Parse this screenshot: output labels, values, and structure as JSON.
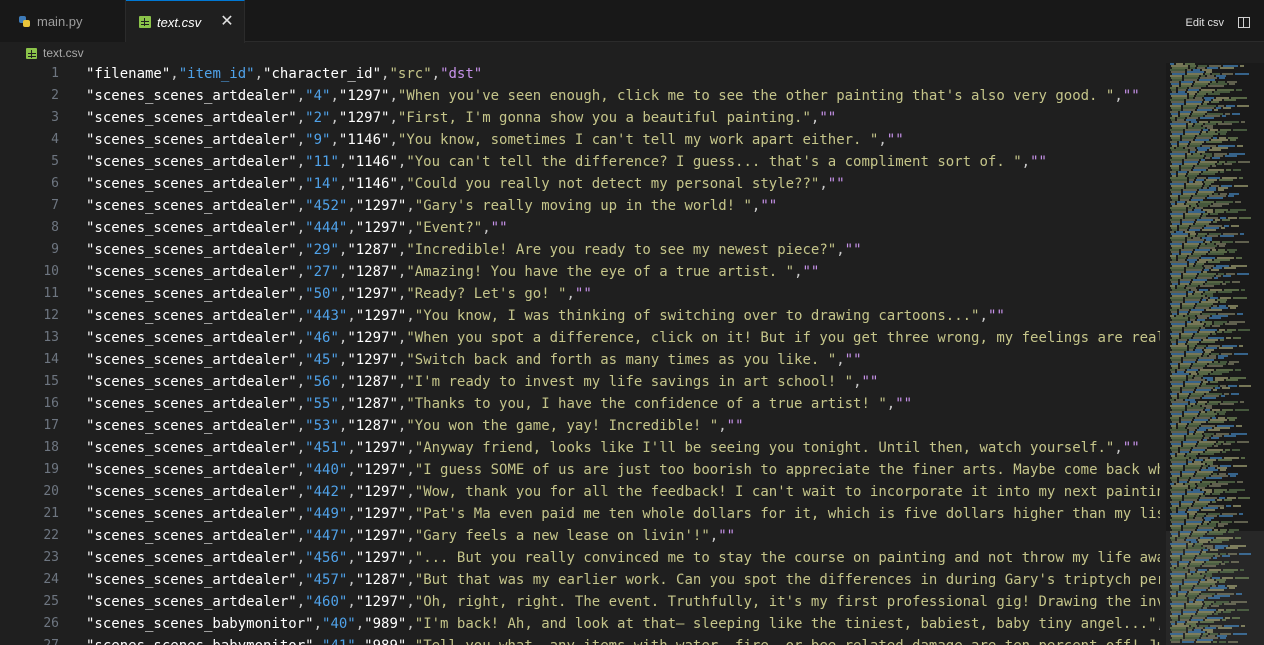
{
  "tabs": [
    {
      "label": "main.py",
      "icon": "python-icon",
      "active": false
    },
    {
      "label": "text.csv",
      "icon": "csv-file-icon",
      "active": true
    }
  ],
  "toolbar": {
    "edit_csv": "Edit csv",
    "split_icon": "split-editor-icon"
  },
  "breadcrumb": {
    "file": "text.csv"
  },
  "colors": {
    "col1": "#ffffff",
    "col2": "#4fa1e8",
    "col3": "#ffffff",
    "col4": "#c5c58a",
    "col5": "#c792ea",
    "accent": "#0078d4"
  },
  "lines": [
    {
      "n": "1",
      "cells": [
        "\"filename\"",
        "\"item_id\"",
        "\"character_id\"",
        "\"src\"",
        "\"dst\""
      ]
    },
    {
      "n": "2",
      "cells": [
        "\"scenes_scenes_artdealer\"",
        "\"4\"",
        "\"1297\"",
        "\"When you've seen enough, click me to see the other painting that's also very good. \"",
        "\"\""
      ]
    },
    {
      "n": "3",
      "cells": [
        "\"scenes_scenes_artdealer\"",
        "\"2\"",
        "\"1297\"",
        "\"First, I'm gonna show you a beautiful painting.\"",
        "\"\""
      ]
    },
    {
      "n": "4",
      "cells": [
        "\"scenes_scenes_artdealer\"",
        "\"9\"",
        "\"1146\"",
        "\"You know, sometimes I can't tell my work apart either. \"",
        "\"\""
      ]
    },
    {
      "n": "5",
      "cells": [
        "\"scenes_scenes_artdealer\"",
        "\"11\"",
        "\"1146\"",
        "\"You can't tell the difference? I guess... that's a compliment sort of. \"",
        "\"\""
      ]
    },
    {
      "n": "6",
      "cells": [
        "\"scenes_scenes_artdealer\"",
        "\"14\"",
        "\"1146\"",
        "\"Could you really not detect my personal style??\"",
        "\"\""
      ]
    },
    {
      "n": "7",
      "cells": [
        "\"scenes_scenes_artdealer\"",
        "\"452\"",
        "\"1297\"",
        "\"Gary's really moving up in the world! \"",
        "\"\""
      ]
    },
    {
      "n": "8",
      "cells": [
        "\"scenes_scenes_artdealer\"",
        "\"444\"",
        "\"1297\"",
        "\"Event?\"",
        "\"\""
      ]
    },
    {
      "n": "9",
      "cells": [
        "\"scenes_scenes_artdealer\"",
        "\"29\"",
        "\"1287\"",
        "\"Incredible! Are you ready to see my newest piece?\"",
        "\"\""
      ]
    },
    {
      "n": "10",
      "cells": [
        "\"scenes_scenes_artdealer\"",
        "\"27\"",
        "\"1287\"",
        "\"Amazing! You have the eye of a true artist. \"",
        "\"\""
      ]
    },
    {
      "n": "11",
      "cells": [
        "\"scenes_scenes_artdealer\"",
        "\"50\"",
        "\"1297\"",
        "\"Ready? Let's go! \"",
        "\"\""
      ]
    },
    {
      "n": "12",
      "cells": [
        "\"scenes_scenes_artdealer\"",
        "\"443\"",
        "\"1297\"",
        "\"You know, I was thinking of switching over to drawing cartoons...\"",
        "\"\""
      ]
    },
    {
      "n": "13",
      "cells": [
        "\"scenes_scenes_artdealer\"",
        "\"46\"",
        "\"1297\"",
        "\"When you spot a difference, click on it! But if you get three wrong, my feelings are really goi",
        ""
      ]
    },
    {
      "n": "14",
      "cells": [
        "\"scenes_scenes_artdealer\"",
        "\"45\"",
        "\"1297\"",
        "\"Switch back and forth as many times as you like. \"",
        "\"\""
      ]
    },
    {
      "n": "15",
      "cells": [
        "\"scenes_scenes_artdealer\"",
        "\"56\"",
        "\"1287\"",
        "\"I'm ready to invest my life savings in art school! \"",
        "\"\""
      ]
    },
    {
      "n": "16",
      "cells": [
        "\"scenes_scenes_artdealer\"",
        "\"55\"",
        "\"1287\"",
        "\"Thanks to you, I have the confidence of a true artist! \"",
        "\"\""
      ]
    },
    {
      "n": "17",
      "cells": [
        "\"scenes_scenes_artdealer\"",
        "\"53\"",
        "\"1287\"",
        "\"You won the game, yay! Incredible! \"",
        "\"\""
      ]
    },
    {
      "n": "18",
      "cells": [
        "\"scenes_scenes_artdealer\"",
        "\"451\"",
        "\"1297\"",
        "\"Anyway friend, looks like I'll be seeing you tonight. Until then, watch yourself.\"",
        "\"\""
      ]
    },
    {
      "n": "19",
      "cells": [
        "\"scenes_scenes_artdealer\"",
        "\"440\"",
        "\"1297\"",
        "\"I guess SOME of us are just too boorish to appreciate the finer arts. Maybe come back when you",
        ""
      ]
    },
    {
      "n": "20",
      "cells": [
        "\"scenes_scenes_artdealer\"",
        "\"442\"",
        "\"1297\"",
        "\"Wow, thank you for all the feedback! I can't wait to incorporate it into my next painting seri",
        ""
      ]
    },
    {
      "n": "21",
      "cells": [
        "\"scenes_scenes_artdealer\"",
        "\"449\"",
        "\"1297\"",
        "\"Pat's Ma even paid me ten whole dollars for it, which is five dollars higher than my listed on",
        ""
      ]
    },
    {
      "n": "22",
      "cells": [
        "\"scenes_scenes_artdealer\"",
        "\"447\"",
        "\"1297\"",
        "\"Gary feels a new lease on livin'!\"",
        "\"\""
      ]
    },
    {
      "n": "23",
      "cells": [
        "\"scenes_scenes_artdealer\"",
        "\"456\"",
        "\"1297\"",
        "\"... But you really convinced me to stay the course on painting and not throw my life away! \"",
        "\""
      ]
    },
    {
      "n": "24",
      "cells": [
        "\"scenes_scenes_artdealer\"",
        "\"457\"",
        "\"1287\"",
        "\"But that was my earlier work. Can you spot the differences in during Gary's triptych period? \"",
        ""
      ]
    },
    {
      "n": "25",
      "cells": [
        "\"scenes_scenes_artdealer\"",
        "\"460\"",
        "\"1297\"",
        "\"Oh, right, right. The event. Truthfully, it's my first professional gig! Drawing the invitatio",
        ""
      ]
    },
    {
      "n": "26",
      "cells": [
        "\"scenes_scenes_babymonitor\"",
        "\"40\"",
        "\"989\"",
        "\"I'm back! Ah, and look at that— sleeping like the tiniest, babiest, baby tiny angel...\"",
        "\"\""
      ]
    },
    {
      "n": "27",
      "cells": [
        "\"scenes_scenes_babymonitor\"",
        "\"41\"",
        "\"989\"",
        "\"Tell you what, any items with water, fire, or bee related damage are ten percent off! Just for",
        ""
      ]
    }
  ]
}
